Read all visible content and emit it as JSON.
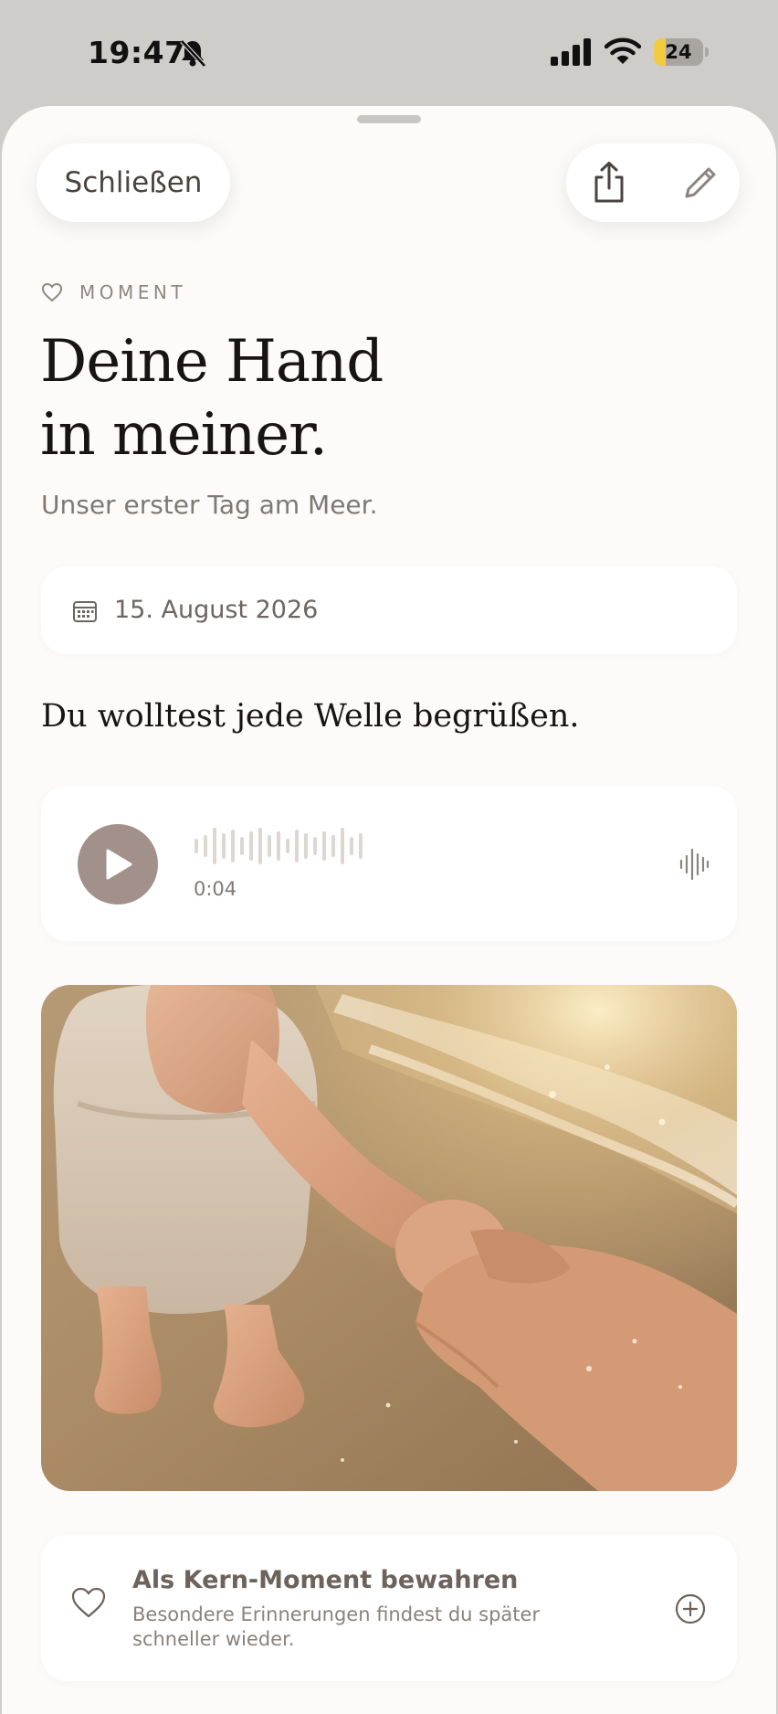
{
  "status_bar": {
    "time": "19:47",
    "battery_level": "24",
    "battery_fraction": 0.24
  },
  "header": {
    "close_label": "Schließen"
  },
  "moment": {
    "tag": "MOMENT",
    "title_line1": "Deine Hand",
    "title_line2": "in meiner.",
    "subtitle": "Unser erster Tag am Meer.",
    "date": "15. August 2026",
    "quote": "Du wolltest jede Welle begrüßen."
  },
  "audio": {
    "duration": "0:04"
  },
  "kern": {
    "title": "Als Kern-Moment bewahren",
    "description": "Besondere Erinnerungen findest du später schneller wieder."
  },
  "colors": {
    "background": "#fcfbfa",
    "play_button": "#a1918a",
    "battery_fill": "#f2cc3e",
    "muted_text": "#807873"
  },
  "icons": [
    "bell-slash-icon",
    "cellular-signal-icon",
    "wifi-icon",
    "battery-icon",
    "share-icon",
    "pencil-icon",
    "heart-icon",
    "calendar-icon",
    "play-icon",
    "waveform-icon",
    "plus-circle-icon"
  ]
}
